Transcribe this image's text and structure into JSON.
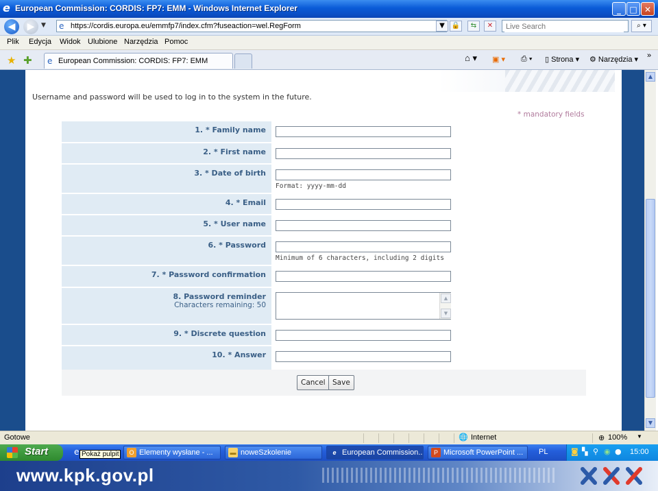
{
  "window": {
    "title": "European Commission: CORDIS: FP7: EMM - Windows Internet Explorer"
  },
  "addressbar": {
    "url": "https://cordis.europa.eu/emmfp7/index.cfm?fuseaction=wel.RegForm",
    "search_placeholder": "Live Search"
  },
  "menubar": {
    "items": [
      "Plik",
      "Edycja",
      "Widok",
      "Ulubione",
      "Narzędzia",
      "Pomoc"
    ]
  },
  "tabbar": {
    "active_tab": "European Commission: CORDIS: FP7: EMM",
    "cmd_page": "Strona",
    "cmd_tools": "Narzędzia"
  },
  "form": {
    "intro": "Username and password will be used to log in to the system in the future.",
    "mandatory_note": "* mandatory fields",
    "fields": [
      {
        "label": "1. * Family name",
        "value": ""
      },
      {
        "label": "2. * First name",
        "value": ""
      },
      {
        "label": "3. * Date of birth",
        "value": "",
        "hint": "Format: yyyy-mm-dd"
      },
      {
        "label": "4. * Email",
        "value": ""
      },
      {
        "label": "5. * User name",
        "value": ""
      },
      {
        "label": "6. * Password",
        "value": "",
        "hint": "Minimum of 6 characters, including 2 digits"
      },
      {
        "label": "7. * Password confirmation",
        "value": ""
      },
      {
        "label": "8. Password reminder",
        "sublabel": "Characters remaining: 50",
        "value": ""
      },
      {
        "label": "9. * Discrete question",
        "value": ""
      },
      {
        "label": "10. * Answer",
        "value": ""
      }
    ],
    "cancel_label": "Cancel",
    "save_label": "Save"
  },
  "statusbar": {
    "status": "Gotowe",
    "zone": "Internet",
    "zoom": "100%"
  },
  "taskbar": {
    "start_label": "Start",
    "tooltip": "Pokaż pulpit",
    "tasks": [
      {
        "label": "Elementy wysłane - ...",
        "icon": "outlook-icon"
      },
      {
        "label": "noweSzkolenie",
        "icon": "folder-icon"
      },
      {
        "label": "European Commission...",
        "icon": "ie-icon"
      },
      {
        "label": "Microsoft PowerPoint ...",
        "icon": "powerpoint-icon"
      }
    ],
    "language": "PL",
    "clock": "15:00"
  },
  "footer": {
    "site": "www.kpk.gov.pl"
  }
}
